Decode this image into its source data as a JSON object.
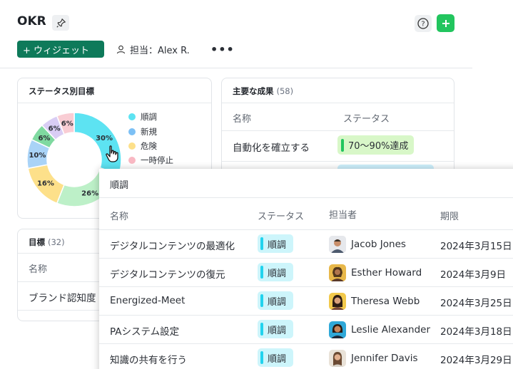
{
  "header": {
    "title": "OKR",
    "widget_button": "+ ウィジェット",
    "owner_label": "担当：Alex R.",
    "more": "•••"
  },
  "colors": {
    "brand": "#0e7a5a",
    "add": "#22c55e",
    "on_track": "#5de3f2",
    "new": "#7cc0f5",
    "at_risk": "#fde08a",
    "paused": "#f9b8c3"
  },
  "status_card": {
    "title": "ステータス別目標",
    "legend": [
      "順調",
      "新規",
      "危険",
      "一時停止"
    ],
    "labels": [
      "30%",
      "26%",
      "16%",
      "10%",
      "6%",
      "6%",
      "6%"
    ]
  },
  "chart_data": {
    "type": "pie",
    "title": "ステータス別目標",
    "categories": [
      "順調",
      "",
      "",
      "新規",
      "",
      "",
      ""
    ],
    "values": [
      30,
      26,
      16,
      10,
      6,
      6,
      6
    ]
  },
  "key_results": {
    "title": "主要な成果",
    "count": "(58)",
    "columns": [
      "名称",
      "ステータス"
    ],
    "row": {
      "name": "自動化を確立する",
      "status": "70〜90%達成"
    }
  },
  "objectives": {
    "title": "目標",
    "count": "(32)",
    "column": "名称",
    "row": "ブランド認知度"
  },
  "panel": {
    "title": "順調",
    "columns": [
      "名称",
      "ステータス",
      "担当者",
      "期限"
    ],
    "rows": [
      {
        "name": "デジタルコンテンツの最適化",
        "status": "順調",
        "owner": "Jacob Jones",
        "due": "2024年3月15日"
      },
      {
        "name": "デジタルコンテンツの復元",
        "status": "順調",
        "owner": "Esther Howard",
        "due": "2024年3月9日"
      },
      {
        "name": "Energized-Meet",
        "status": "順調",
        "owner": "Theresa Webb",
        "due": "2024年3月25日"
      },
      {
        "name": "PAシステム設定",
        "status": "順調",
        "owner": "Leslie Alexander",
        "due": "2024年3月18日"
      },
      {
        "name": "知識の共有を行う",
        "status": "順調",
        "owner": "Jennifer Davis",
        "due": "2024年3月29日"
      }
    ]
  }
}
